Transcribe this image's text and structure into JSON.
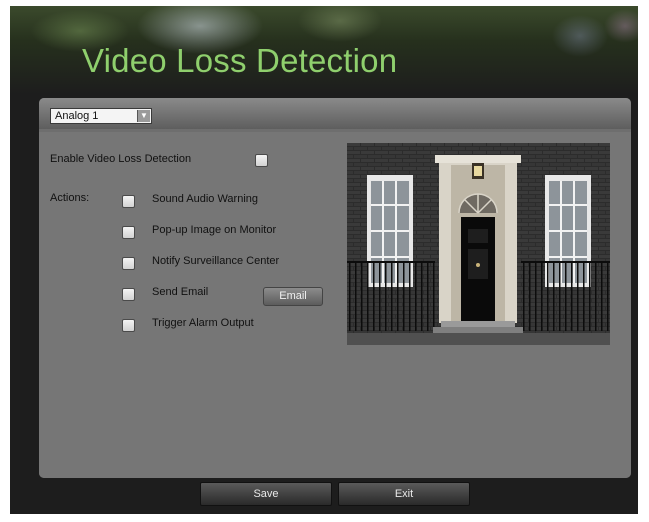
{
  "header": {
    "title": "Video Loss Detection"
  },
  "camera_select": {
    "value": "Analog 1"
  },
  "enable": {
    "label": "Enable Video Loss Detection",
    "checked": false
  },
  "actions": {
    "label": "Actions:",
    "items": [
      {
        "label": "Sound Audio Warning",
        "checked": false
      },
      {
        "label": "Pop-up Image on Monitor",
        "checked": false
      },
      {
        "label": "Notify Surveillance Center",
        "checked": false
      },
      {
        "label": "Send Email",
        "checked": false
      },
      {
        "label": "Trigger Alarm Output",
        "checked": false
      }
    ]
  },
  "email_button": {
    "label": "Email"
  },
  "footer": {
    "save_label": "Save",
    "exit_label": "Exit"
  }
}
